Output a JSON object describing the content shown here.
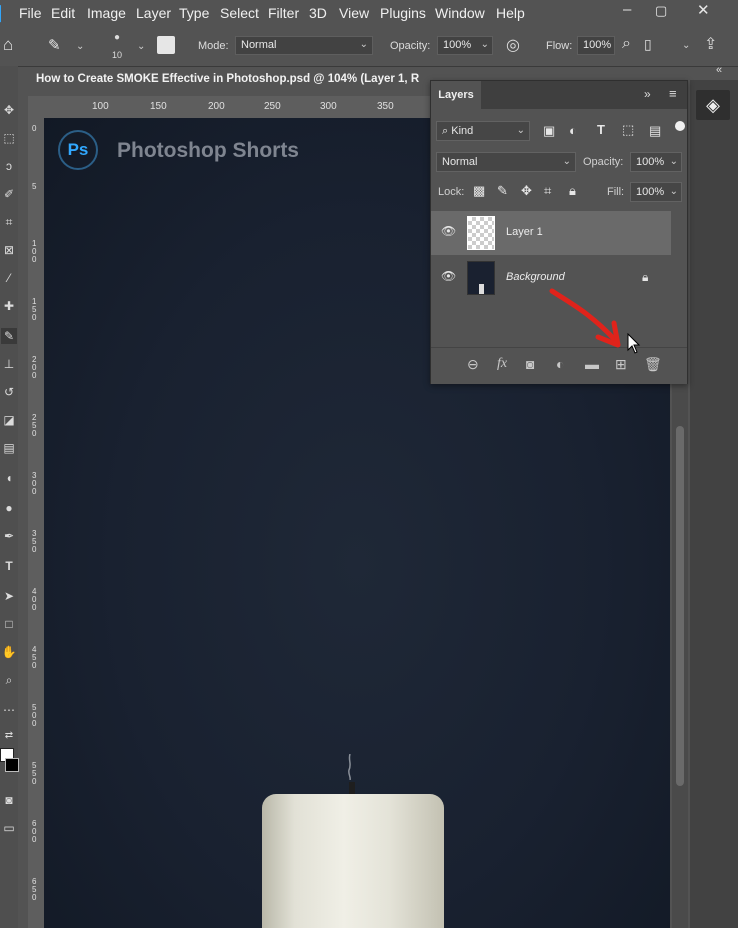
{
  "menubar": {
    "items": [
      "File",
      "Edit",
      "Image",
      "Layer",
      "Type",
      "Select",
      "Filter",
      "3D",
      "View",
      "Plugins",
      "Window",
      "Help"
    ],
    "window_controls": [
      "minimize-icon",
      "restore-icon",
      "close-icon"
    ]
  },
  "options": {
    "brush_size": "10",
    "mode_label": "Mode:",
    "mode_value": "Normal",
    "opacity_label": "Opacity:",
    "opacity_value": "100%",
    "flow_label": "Flow:",
    "flow_value": "100%"
  },
  "document": {
    "tab_title": "How to Create SMOKE Effective in Photoshop.psd @ 104% (Layer 1, R"
  },
  "rulers": {
    "h": [
      "100",
      "150",
      "200",
      "250",
      "300",
      "350"
    ],
    "v": [
      "0",
      "5",
      "1 0 0",
      "1 5 0",
      "2 0 0",
      "2 5 0",
      "3 0 0",
      "3 5 0",
      "4 0 0",
      "4 5 0",
      "5 0 0",
      "5 5 0",
      "6 0 0",
      "6 5 0"
    ]
  },
  "canvas": {
    "brand_text": "Photoshop Shorts",
    "logo_text": "Ps"
  },
  "layers_panel": {
    "tab": "Layers",
    "filter_label": "Kind",
    "blend_mode": "Normal",
    "opacity_label": "Opacity:",
    "opacity_value": "100%",
    "lock_label": "Lock:",
    "fill_label": "Fill:",
    "fill_value": "100%",
    "layers": [
      {
        "name": "Layer 1",
        "selected": true,
        "visible": true
      },
      {
        "name": "Background",
        "selected": false,
        "visible": true,
        "locked": true
      }
    ],
    "footer_icons": [
      "link-layers-icon",
      "fx-icon",
      "layer-mask-icon",
      "adjustment-layer-icon",
      "new-group-icon",
      "new-layer-icon",
      "delete-layer-icon"
    ]
  },
  "colors": {
    "accent_arrow": "#e0231b",
    "ps_blue": "#31a8ff",
    "canvas_bg": "#192130"
  }
}
